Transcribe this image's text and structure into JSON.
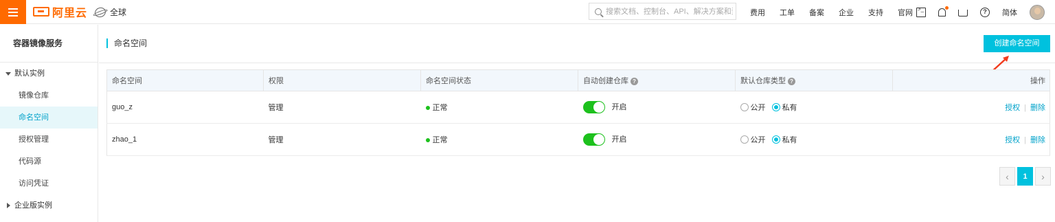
{
  "topbar": {
    "logo_text": "阿里云",
    "region": "全球",
    "search_placeholder": "搜索文档、控制台、API、解决方案和资源",
    "nav": [
      "费用",
      "工单",
      "备案",
      "企业",
      "支持",
      "官网"
    ],
    "lang": "简体",
    "accent_color": "#ff6a00"
  },
  "sidebar": {
    "title": "容器镜像服务",
    "group_default": "默认实例",
    "items": [
      "镜像仓库",
      "命名空间",
      "授权管理",
      "代码源",
      "访问凭证"
    ],
    "active_item": "命名空间",
    "group_enterprise": "企业版实例"
  },
  "main": {
    "page_title": "命名空间",
    "create_button": "创建命名空间",
    "primary_color": "#00c1de"
  },
  "table": {
    "headers": {
      "namespace": "命名空间",
      "permission": "权限",
      "status": "命名空间状态",
      "auto_create": "自动创建仓库",
      "default_type": "默认仓库类型",
      "actions": "操作"
    },
    "help_glyph": "?",
    "rows": [
      {
        "namespace": "guo_z",
        "permission": "管理",
        "status": "正常",
        "auto_create_label": "开启",
        "auto_create_on": true,
        "type_public": "公开",
        "type_private": "私有",
        "selected": "私有",
        "action_auth": "授权",
        "action_delete": "删除",
        "sep": "|"
      },
      {
        "namespace": "zhao_1",
        "permission": "管理",
        "status": "正常",
        "auto_create_label": "开启",
        "auto_create_on": true,
        "type_public": "公开",
        "type_private": "私有",
        "selected": "私有",
        "action_auth": "授权",
        "action_delete": "删除",
        "sep": "|"
      }
    ]
  },
  "pagination": {
    "prev": "‹",
    "current": "1",
    "next": "›"
  }
}
